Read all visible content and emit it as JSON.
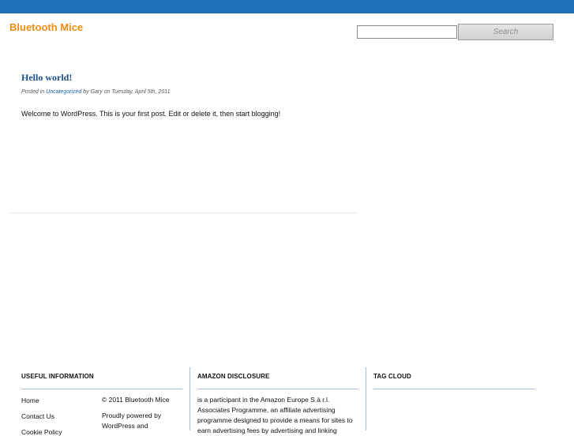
{
  "header": {
    "site_title": "Bluetooth Mice",
    "search_placeholder": "",
    "search_button_label": "Search",
    "bar_color": "#1f72b8",
    "title_color": "#f08c14"
  },
  "post": {
    "title": "Hello world!",
    "meta_prefix": "Posted in",
    "category": "Uncategorized",
    "meta_suffix": "by Gary on Tuesday, April 5th, 2011",
    "body": "Welcome to WordPress. This is your first post. Edit or delete it, then start blogging!"
  },
  "footer": {
    "useful": {
      "heading": "USEFUL INFORMATION",
      "links": [
        "Home",
        "Contact Us",
        "Cookie Policy"
      ],
      "copyright": "© 2011 Bluetooth Mice",
      "powered": "Proudly powered by WordPress and"
    },
    "amazon": {
      "heading": "AMAZON DISCLOSURE",
      "text": "is a participant in the Amazon Europe S.à r.l. Associates Programme, an affiliate advertising programme designed to provide a means for sites to earn advertising fees by advertising and linking"
    },
    "tags": {
      "heading": "TAG CLOUD"
    }
  }
}
